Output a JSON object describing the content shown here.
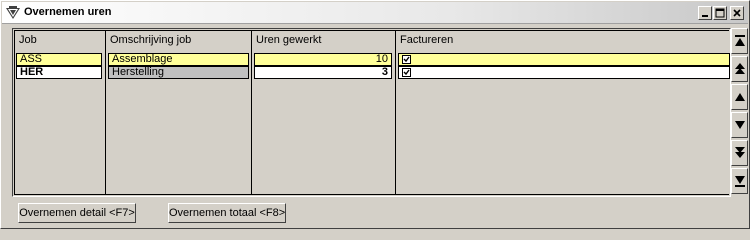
{
  "window": {
    "title": "Overnemen uren",
    "icon": "app-logo-icon",
    "controls": [
      "minimize-icon",
      "maximize-icon",
      "close-icon"
    ]
  },
  "grid": {
    "columns": [
      "Job",
      "Omschrijving job",
      "Uren gewerkt",
      "Factureren"
    ],
    "rows": [
      {
        "job": "ASS",
        "omschrijving": "Assemblage",
        "uren": "10",
        "factureren": true,
        "selected": true
      },
      {
        "job": "HER",
        "omschrijving": "Herstelling",
        "uren": "3",
        "factureren": true,
        "selected": false
      }
    ]
  },
  "scrollbar": {
    "buttons": [
      "first-page-icon",
      "page-up-icon",
      "line-up-icon",
      "line-down-icon",
      "page-down-icon",
      "last-page-icon"
    ]
  },
  "buttons": {
    "detail": "Overnemen detail <F7>",
    "totaal": "Overnemen totaal <F8>"
  },
  "colors": {
    "selected_row": "#ffff99",
    "window_bg": "#d4d0c8",
    "readonly_cell": "#c0c0c0"
  }
}
